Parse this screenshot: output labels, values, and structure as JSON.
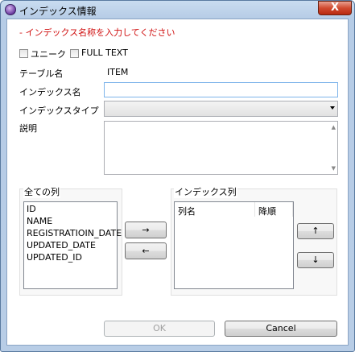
{
  "window": {
    "title": "インデックス情報",
    "close_glyph": "X"
  },
  "error_message": "- インデックス名称を入力してください",
  "checkboxes": {
    "unique_label": "ユニーク",
    "fulltext_label": "FULL TEXT"
  },
  "form": {
    "table_name_label": "テーブル名",
    "table_name_value": "ITEM",
    "index_name_label": "インデックス名",
    "index_name_value": "",
    "index_type_label": "インデックスタイプ",
    "index_type_value": "",
    "description_label": "説明",
    "description_value": ""
  },
  "all_columns": {
    "title": "全ての列",
    "items": [
      "ID",
      "NAME",
      "REGISTRATIOIN_DATE",
      "UPDATED_DATE",
      "UPDATED_ID"
    ]
  },
  "move_buttons": {
    "add": "→",
    "remove": "←"
  },
  "index_columns": {
    "title": "インデックス列",
    "col_name_header": "列名",
    "desc_header": "降順"
  },
  "order_buttons": {
    "up": "↑",
    "down": "↓"
  },
  "dialog_buttons": {
    "ok": "OK",
    "cancel": "Cancel"
  },
  "scroll_glyphs": {
    "up": "▲",
    "down": "▼"
  }
}
